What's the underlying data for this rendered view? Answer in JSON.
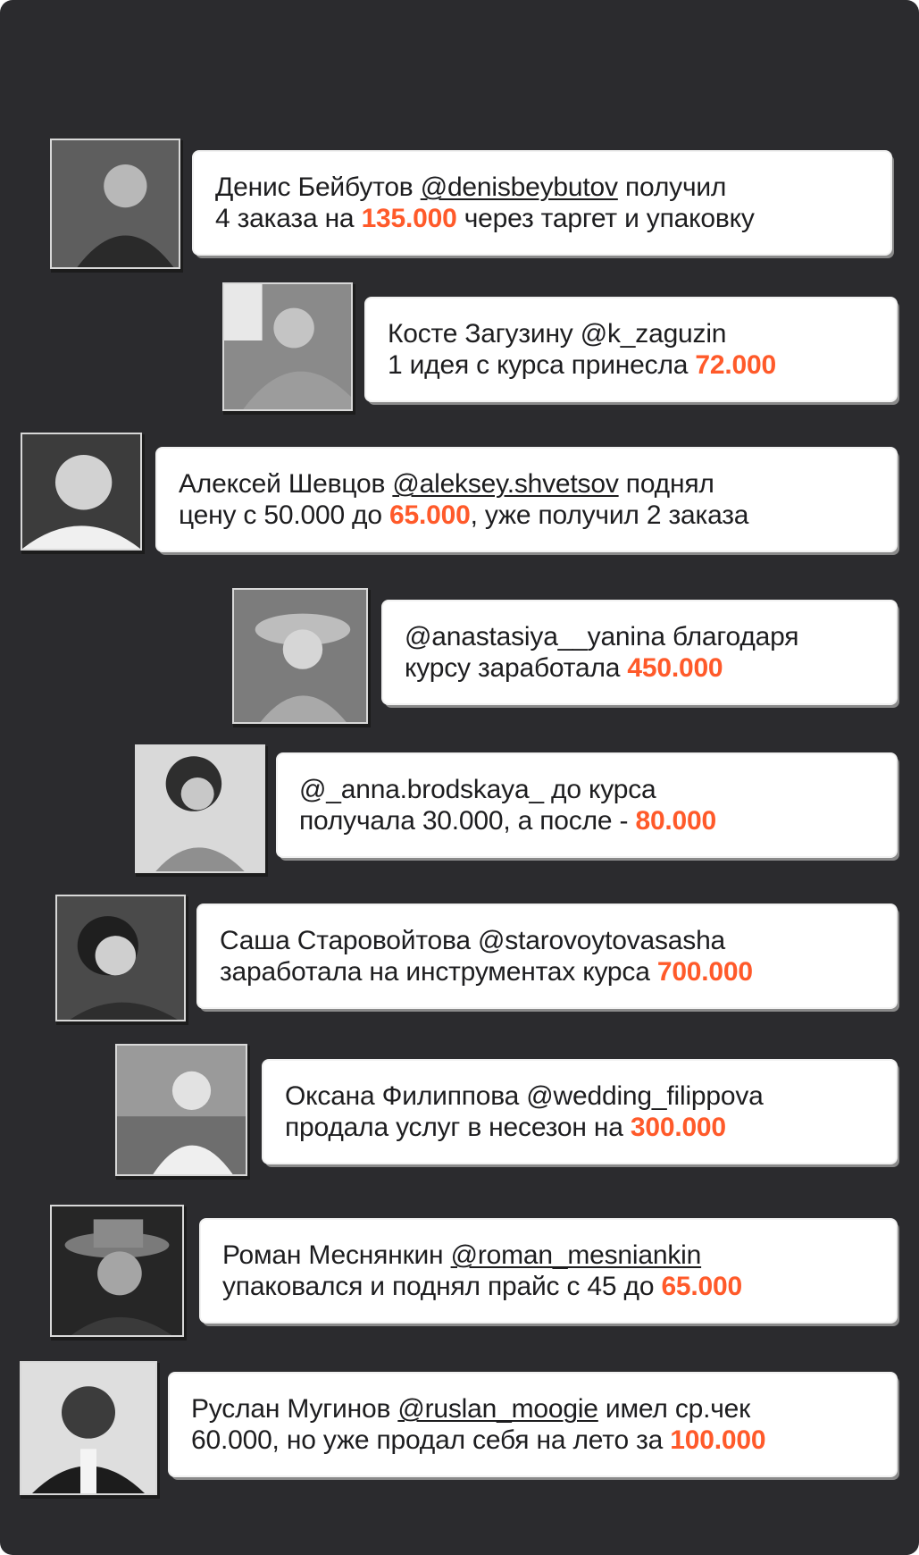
{
  "colors": {
    "background": "#2b2b2e",
    "card": "#ffffff",
    "accent": "#ff5a2a",
    "text": "#1d1d1f"
  },
  "testimonials": [
    {
      "photo": "portrait-photo",
      "l1a": "Денис Бейбутов ",
      "handle": "@denisbeybutov",
      "l1b": " получил",
      "l2a": "4 заказа на ",
      "amount": "135.000",
      "l2b": " через таргет и упаковку"
    },
    {
      "photo": "portrait-photo",
      "l1a": "Косте Загузину ",
      "handle": "@k_zaguzin",
      "l1b": "",
      "l2a": "1 идея с курса принесла ",
      "amount": "72.000",
      "l2b": ""
    },
    {
      "photo": "portrait-photo",
      "l1a": "Алексей Шевцов ",
      "handle": "@aleksey.shvetsov",
      "l1b": " поднял",
      "l2a": "цену с 50.000 до ",
      "amount": "65.000",
      "l2b": ", уже получил 2 заказа"
    },
    {
      "photo": "portrait-photo",
      "l1a": "",
      "handle": "@anastasiya__yanina",
      "l1b": " благодаря",
      "l2a": "курсу заработала ",
      "amount": "450.000",
      "l2b": ""
    },
    {
      "photo": "portrait-photo",
      "l1a": "",
      "handle": "@_anna.brodskaya_",
      "l1b": " до курса",
      "l2a": "получала 30.000, а после - ",
      "amount": "80.000",
      "l2b": ""
    },
    {
      "photo": "portrait-photo",
      "l1a": "Саша Старовойтова ",
      "handle": "@starovoytovasasha",
      "l1b": "",
      "l2a": "заработала на инструментах курса ",
      "amount": "700.000",
      "l2b": ""
    },
    {
      "photo": "portrait-photo",
      "l1a": "Оксана Филиппова ",
      "handle": "@wedding_filippova",
      "l1b": "",
      "l2a": "продала услуг в несезон на ",
      "amount": "300.000",
      "l2b": ""
    },
    {
      "photo": "portrait-photo",
      "l1a": "Роман Меснянкин ",
      "handle": "@roman_mesniankin",
      "l1b": "",
      "l2a": "упаковался и поднял прайс с 45 до ",
      "amount": "65.000",
      "l2b": ""
    },
    {
      "photo": "portrait-photo",
      "l1a": "Руслан Мугинов ",
      "handle": "@ruslan_moogie",
      "l1b": " имел ср.чек",
      "l2a": "60.000, но уже продал себя на лето за ",
      "amount": "100.000",
      "l2b": ""
    }
  ]
}
